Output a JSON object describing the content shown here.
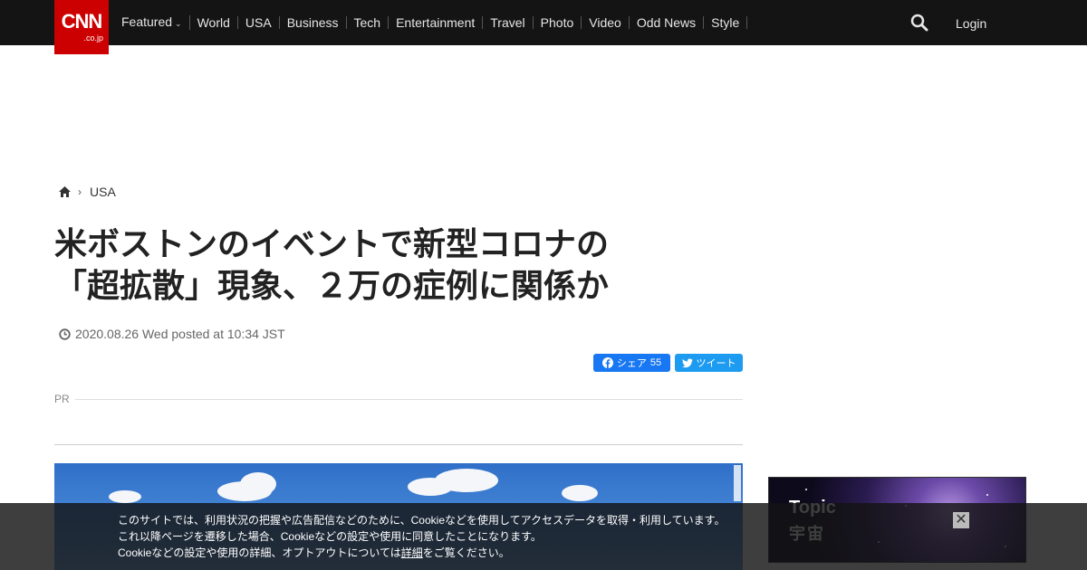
{
  "header": {
    "logo_main": "CNN",
    "logo_sub": ".co.jp",
    "nav": [
      "Featured",
      "World",
      "USA",
      "Business",
      "Tech",
      "Entertainment",
      "Travel",
      "Photo",
      "Video",
      "Odd News",
      "Style"
    ],
    "login_label": "Login"
  },
  "breadcrumb": {
    "section": "USA"
  },
  "article": {
    "title_line1": "米ボストンのイベントで新型コロナの",
    "title_line2": "「超拡散」現象、２万の症例に関係か",
    "date": "2020.08.26 Wed posted at 10:34 JST"
  },
  "social": {
    "share_label": "シェア",
    "share_count": "55",
    "tweet_label": "ツイート"
  },
  "pr_label": "PR",
  "cookie": {
    "line1": "このサイトでは、利用状況の把握や広告配信などのために、Cookieなどを使用してアクセスデータを取得・利用しています。",
    "line2": "これ以降ページを遷移した場合、Cookieなどの設定や使用に同意したことになります。",
    "line3_pre": "Cookieなどの設定や使用の詳細、オプトアウトについては",
    "line3_link": "詳細",
    "line3_post": "をご覧ください。"
  },
  "ad": {
    "topic": "Topic",
    "subtitle": "宇宙"
  },
  "colors": {
    "brand": "#cc0000",
    "topbar": "#141414",
    "facebook": "#1877f2",
    "twitter": "#1d9bf0"
  }
}
